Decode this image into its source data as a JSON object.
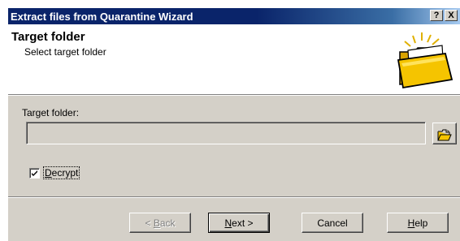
{
  "window": {
    "title": "Extract files from Quarantine Wizard",
    "help_button": "?",
    "close_button": "X"
  },
  "header": {
    "title": "Target folder",
    "subtitle": "Select target folder",
    "art_icon": "open-folder-icon"
  },
  "form": {
    "target_label": "Target folder:",
    "target_value": "",
    "browse_icon": "folder-open-icon",
    "decrypt": {
      "label_pre": "",
      "label_accel": "D",
      "label_post": "ecrypt",
      "checked": true
    }
  },
  "buttons": {
    "back": {
      "arrow": "< ",
      "accel": "B",
      "rest": "ack",
      "enabled": false
    },
    "next": {
      "accel": "N",
      "rest": "ext >",
      "default": true
    },
    "cancel": {
      "label": "Cancel"
    },
    "help": {
      "accel": "H",
      "rest": "elp"
    }
  },
  "colors": {
    "title_bar": "#0a246a",
    "face": "#d4d0c8",
    "folder": "#f5c400"
  }
}
